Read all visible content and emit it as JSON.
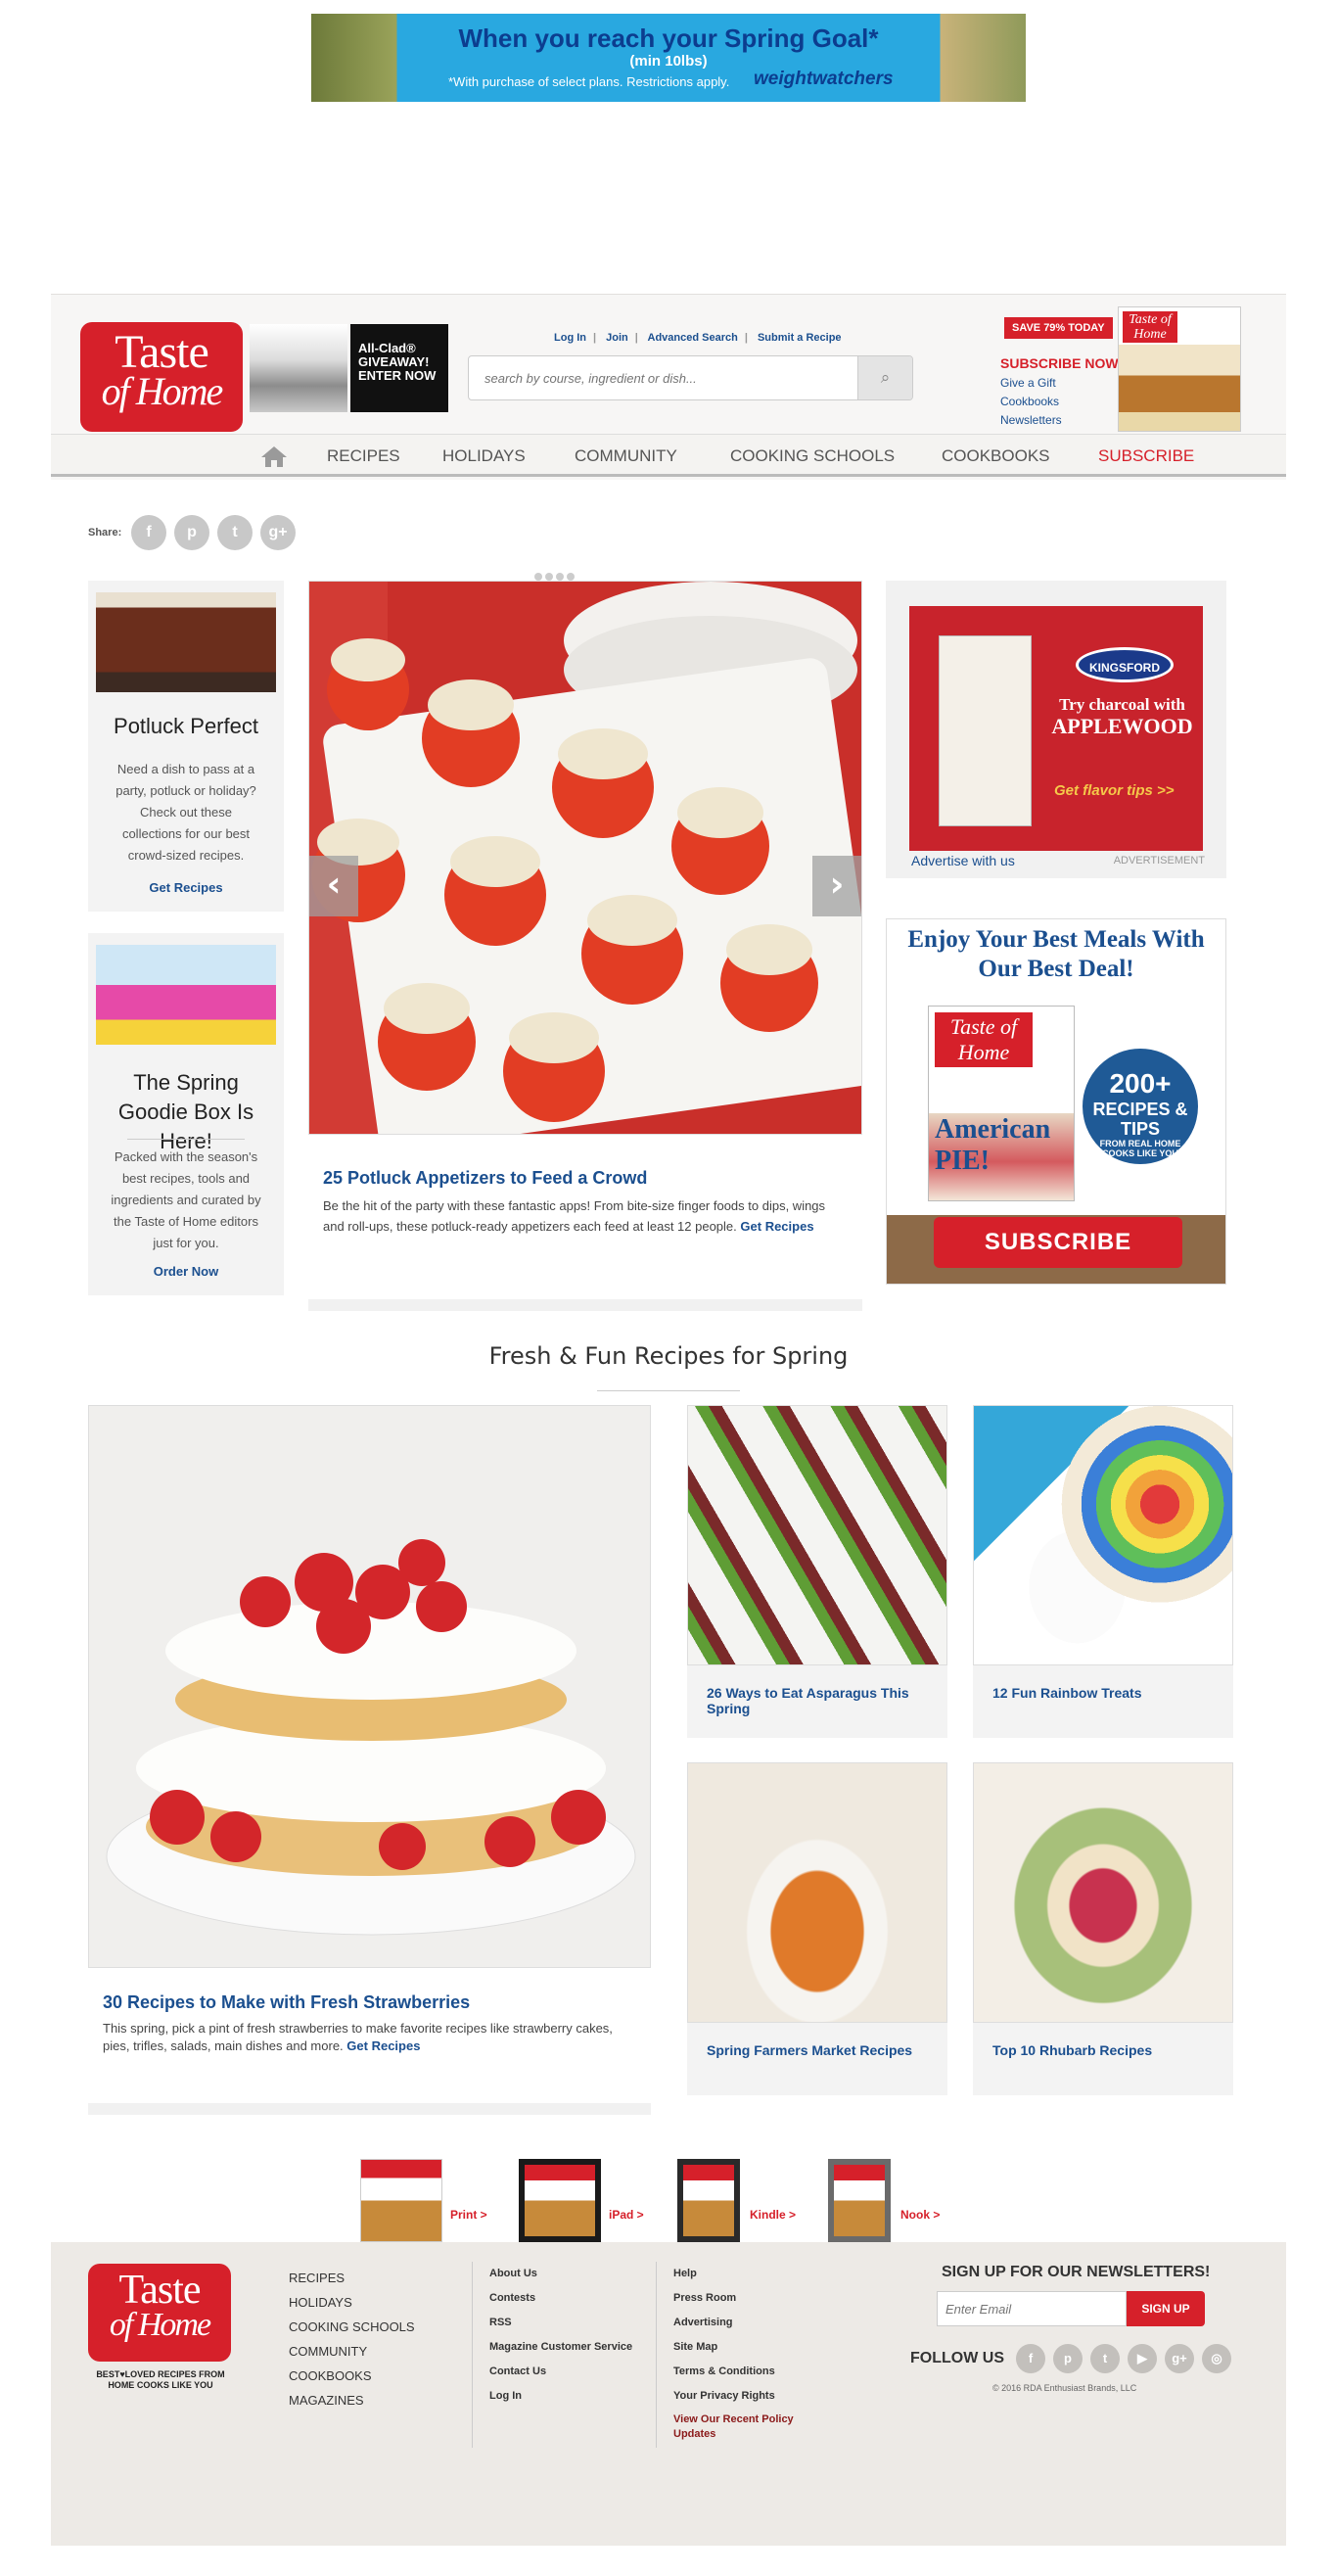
{
  "top_ad": {
    "headline": "When you reach your Spring Goal*",
    "sub": "(min 10lbs)",
    "fine": "*With purchase of select plans. Restrictions apply.",
    "brand": "weightwatchers"
  },
  "header": {
    "logo_line1": "Taste",
    "logo_line2": "of Home",
    "tagline": "BEST♥LOVED RECIPES FROM HOME COOKS LIKE YOU",
    "promo": "All-Clad® GIVEAWAY! ENTER NOW",
    "links": [
      "Log In",
      "Join",
      "Advanced Search",
      "Submit a Recipe"
    ],
    "search_placeholder": "search by course, ingredient or dish...",
    "save_badge": "SAVE 79% TODAY",
    "subscribe_now": "SUBSCRIBE NOW",
    "sub_links": [
      "Give a Gift",
      "Cookbooks",
      "Newsletters"
    ],
    "mag_title": "Taste of Home"
  },
  "nav": {
    "items": [
      "RECIPES",
      "HOLIDAYS",
      "COMMUNITY",
      "COOKING SCHOOLS",
      "COOKBOOKS",
      "SUBSCRIBE"
    ],
    "accent": "#d6202a"
  },
  "share": {
    "label": "Share:",
    "icons": [
      "f",
      "p",
      "t",
      "g+"
    ]
  },
  "left_cards": [
    {
      "title": "Potluck Perfect",
      "text": "Need a dish to pass at a party, potluck or holiday? Check out these collections for our best crowd-sized recipes.",
      "cta": "Get Recipes"
    },
    {
      "title": "The Spring Goodie Box Is Here!",
      "text": "Packed with the season's best recipes, tools and ingredients and curated by the Taste of Home editors just for you.",
      "cta": "Order Now"
    }
  ],
  "slider": {
    "title": "25 Potluck Appetizers to Feed a Crowd",
    "desc": "Be the hit of the party with these fantastic apps! From bite-size finger foods to dips, wings and roll-ups, these potluck-ready appetizers each feed at least 12 people.",
    "cta": "Get Recipes",
    "prev": "‹",
    "next": "›"
  },
  "ad_kingsford": {
    "brand": "KINGSFORD",
    "headline1": "Try charcoal with",
    "headline2": "APPLEWOOD",
    "cta": "Get flavor tips >>",
    "advertise": "Advertise with us",
    "label": "ADVERTISEMENT"
  },
  "ad_sub": {
    "headline": "Enjoy Your Best Meals With Our Best Deal!",
    "mag_title": "Taste of Home",
    "mag_pie": "American PIE!",
    "badge1": "200+",
    "badge2": "RECIPES & TIPS",
    "badge3": "FROM REAL HOME COOKS LIKE YOU",
    "button": "SUBSCRIBE"
  },
  "section_title": "Fresh & Fun Recipes for Spring",
  "feature": {
    "title": "30 Recipes to Make with Fresh Strawberries",
    "desc": "This spring, pick a pint of fresh strawberries to make favorite recipes like strawberry cakes, pies, trifles, salads, main dishes and more.",
    "cta": "Get Recipes"
  },
  "tiles": [
    "26 Ways to Eat Asparagus This Spring",
    "12 Fun Rainbow Treats",
    "Spring Farmers Market Recipes",
    "Top 10 Rhubarb Recipes"
  ],
  "formats": [
    "Print >",
    "iPad >",
    "Kindle >",
    "Nook >"
  ],
  "footer": {
    "col1": [
      "RECIPES",
      "HOLIDAYS",
      "COOKING SCHOOLS",
      "COMMUNITY",
      "COOKBOOKS",
      "MAGAZINES"
    ],
    "col2": [
      "About Us",
      "Contests",
      "RSS",
      "Magazine Customer Service",
      "Contact Us",
      "Log In"
    ],
    "col3": [
      "Help",
      "Press Room",
      "Advertising",
      "Site Map",
      "Terms & Conditions",
      "Your Privacy Rights",
      "View Our Recent Policy Updates"
    ],
    "newsletter_title": "SIGN UP FOR OUR NEWSLETTERS!",
    "email_placeholder": "Enter Email",
    "signup": "SIGN UP",
    "follow": "FOLLOW US",
    "social": [
      "f",
      "p",
      "t",
      "▶",
      "g+",
      "◎"
    ],
    "copyright": "© 2016 RDA Enthusiast Brands, LLC"
  }
}
